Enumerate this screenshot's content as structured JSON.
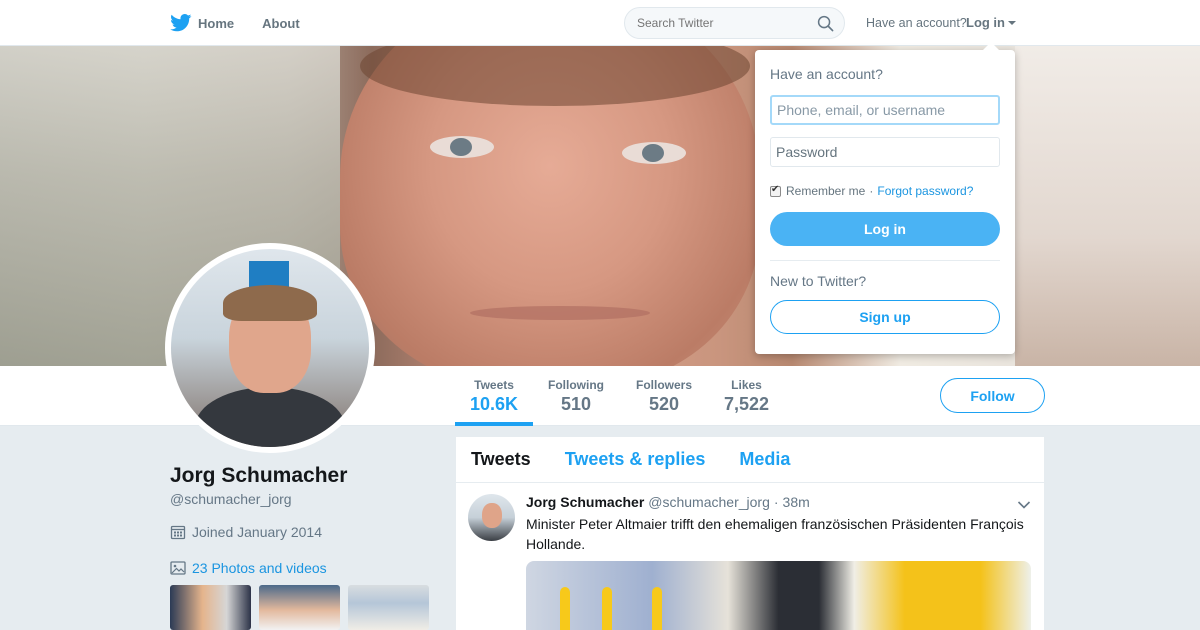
{
  "nav": {
    "home_label": "Home",
    "about_label": "About",
    "search_placeholder": "Search Twitter",
    "have_account": "Have an account?",
    "login_label": "Log in",
    "brand_color": "#1da1f2"
  },
  "profile": {
    "name": "Jorg Schumacher",
    "handle": "@schumacher_jorg",
    "joined": "Joined January 2014",
    "photos_link": "23 Photos and videos",
    "follow_label": "Follow"
  },
  "stats": [
    {
      "label": "Tweets",
      "value": "10.6K"
    },
    {
      "label": "Following",
      "value": "510"
    },
    {
      "label": "Followers",
      "value": "520"
    },
    {
      "label": "Likes",
      "value": "7,522"
    }
  ],
  "timeline": {
    "tabs": [
      "Tweets",
      "Tweets & replies",
      "Media"
    ],
    "active_tab": "Tweets",
    "tweet": {
      "name": "Jorg Schumacher",
      "handle": "@schumacher_jorg",
      "separator": "·",
      "time": "38m",
      "text": "Minister Peter Altmaier trifft den ehemaligen französischen Präsidenten François Hollande."
    }
  },
  "login_dropdown": {
    "title": "Have an account?",
    "username_placeholder": "Phone, email, or username",
    "password_placeholder": "Password",
    "remember_label": "Remember me",
    "separator": "·",
    "forgot_label": "Forgot password?",
    "login_button": "Log in",
    "new_to": "New to Twitter?",
    "signup_button": "Sign up"
  },
  "icons": {
    "logo": "twitter-bird-icon",
    "search": "search-icon",
    "calendar": "calendar-icon",
    "photos": "image-icon",
    "tweet_menu": "chevron-down-icon"
  }
}
